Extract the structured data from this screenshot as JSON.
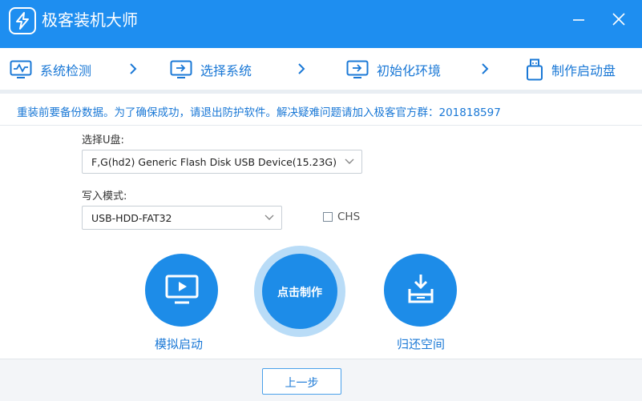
{
  "window": {
    "title": "极客装机大师",
    "logo_icon": "lightning-logo-icon",
    "accent_color": "#1e8ef0"
  },
  "steps": [
    {
      "label": "系统检测",
      "icon": "monitor-check-icon"
    },
    {
      "label": "选择系统",
      "icon": "monitor-arrow-icon"
    },
    {
      "label": "初始化环境",
      "icon": "monitor-arrow-icon"
    },
    {
      "label": "制作启动盘",
      "icon": "usb-drive-icon"
    }
  ],
  "notice": "重装前要备份数据。为了确保成功，请退出防护软件。解决疑难问题请加入极客官方群：201818597",
  "form": {
    "usb_label": "选择U盘:",
    "usb_value": "F,G(hd2) Generic Flash Disk USB Device(15.23G)",
    "mode_label": "写入模式:",
    "mode_value": "USB-HDD-FAT32",
    "chs_label": "CHS",
    "chs_checked": false
  },
  "actions": {
    "simulate_label": "模拟启动",
    "make_label": "点击制作",
    "restore_label": "归还空间"
  },
  "footer": {
    "prev_label": "上一步"
  }
}
